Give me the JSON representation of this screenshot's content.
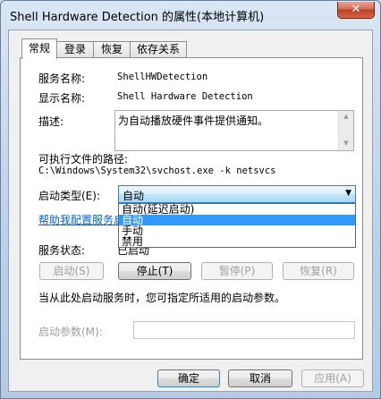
{
  "window": {
    "title": "Shell Hardware Detection 的属性(本地计算机)"
  },
  "tabs": [
    {
      "label": "常规",
      "active": true
    },
    {
      "label": "登录",
      "active": false
    },
    {
      "label": "恢复",
      "active": false
    },
    {
      "label": "依存关系",
      "active": false
    }
  ],
  "general": {
    "service_name_label": "服务名称:",
    "service_name_value": "ShellHWDetection",
    "display_name_label": "显示名称:",
    "display_name_value": "Shell Hardware Detection",
    "description_label": "描述:",
    "description_value": "为自动播放硬件事件提供通知。",
    "exe_path_label": "可执行文件的路径:",
    "exe_path_value": "C:\\Windows\\System32\\svchost.exe -k netsvcs",
    "startup_type_label": "启动类型(E):",
    "startup_type_value": "自动",
    "startup_type_options": [
      "自动(延迟启动)",
      "自动",
      "手动",
      "禁用"
    ],
    "help_link": "帮助我配置服务启",
    "status_label": "服务状态:",
    "status_value": "已启动",
    "start_button": "启动(S)",
    "stop_button": "停止(T)",
    "pause_button": "暂停(P)",
    "resume_button": "恢复(R)",
    "hint_text": "当从此处启动服务时，您可指定所适用的启动参数。",
    "start_params_label": "启动参数(M):",
    "start_params_value": ""
  },
  "footer": {
    "ok_button": "确定",
    "cancel_button": "取消",
    "apply_button": "应用(A)"
  },
  "colors": {
    "selection": "#3399ff",
    "link": "#0066cc"
  }
}
